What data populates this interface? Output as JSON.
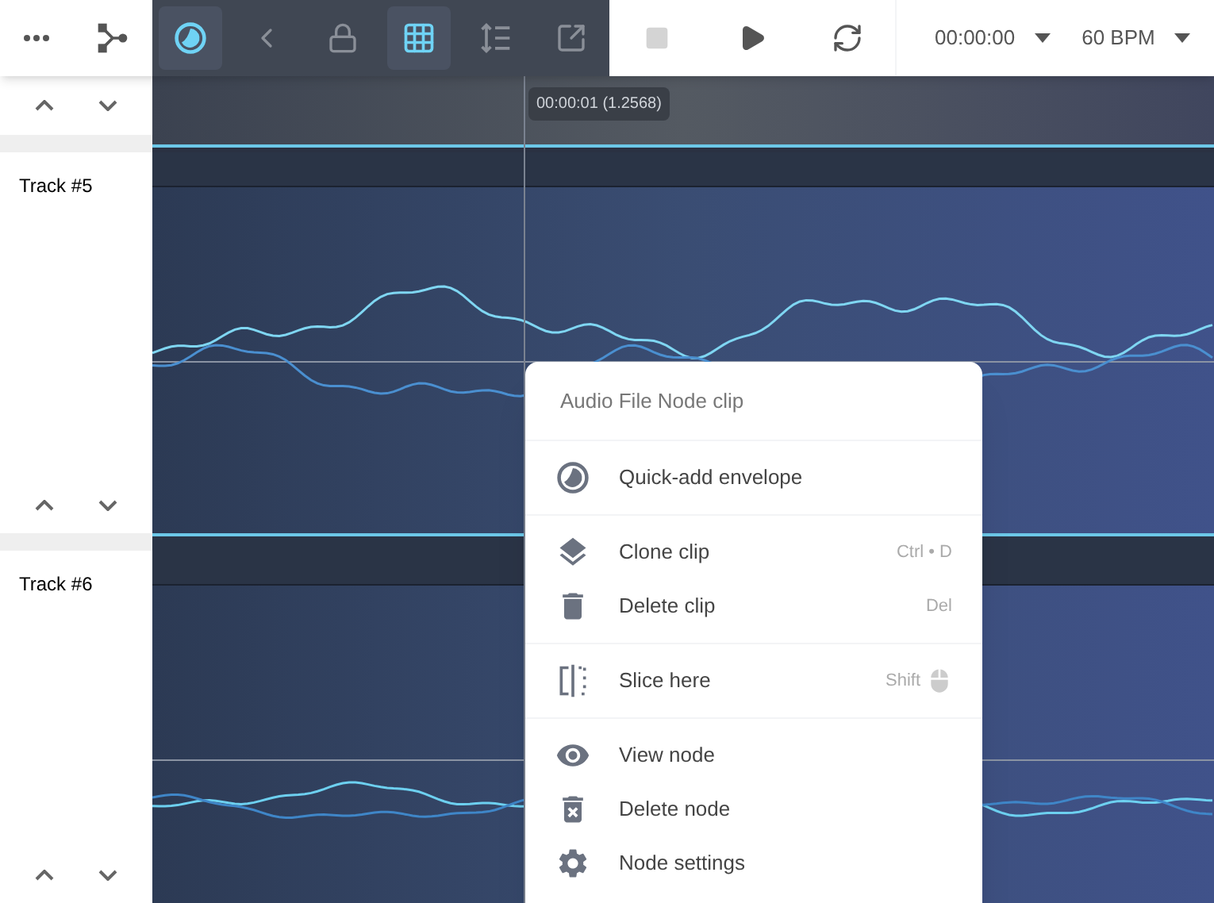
{
  "toolbar": {
    "left_tools": [
      {
        "kind": "more",
        "selected": false
      },
      {
        "kind": "graph",
        "selected": false
      }
    ],
    "edit_tools": [
      {
        "kind": "envelope",
        "selected": true
      },
      {
        "kind": "back",
        "selected": false
      },
      {
        "kind": "lock",
        "selected": false
      },
      {
        "kind": "grid",
        "selected": true
      },
      {
        "kind": "spacing",
        "selected": false
      },
      {
        "kind": "popout",
        "selected": false
      }
    ],
    "transport": [
      {
        "kind": "stop",
        "disabled": true
      },
      {
        "kind": "play",
        "disabled": false
      },
      {
        "kind": "loop",
        "disabled": false
      }
    ],
    "time": "00:00:00",
    "tempo": "60 BPM"
  },
  "playhead": {
    "tooltip": "00:00:01 (1.2568)"
  },
  "tracks": [
    {
      "label": "Track #5"
    },
    {
      "label": "Track #6"
    }
  ],
  "context_menu": {
    "title": "Audio File Node clip",
    "groups": [
      [
        {
          "kind": "envelope",
          "label": "Quick-add envelope"
        }
      ],
      [
        {
          "kind": "clone",
          "label": "Clone clip",
          "shortcut": "Ctrl • D"
        },
        {
          "kind": "delete",
          "label": "Delete clip",
          "shortcut": "Del"
        }
      ],
      [
        {
          "kind": "slice",
          "label": "Slice here",
          "shortcut": "Shift",
          "mouse_hint": true
        }
      ],
      [
        {
          "kind": "view",
          "label": "View node"
        },
        {
          "kind": "remove",
          "label": "Delete node"
        },
        {
          "kind": "settings",
          "label": "Node settings"
        }
      ]
    ]
  }
}
